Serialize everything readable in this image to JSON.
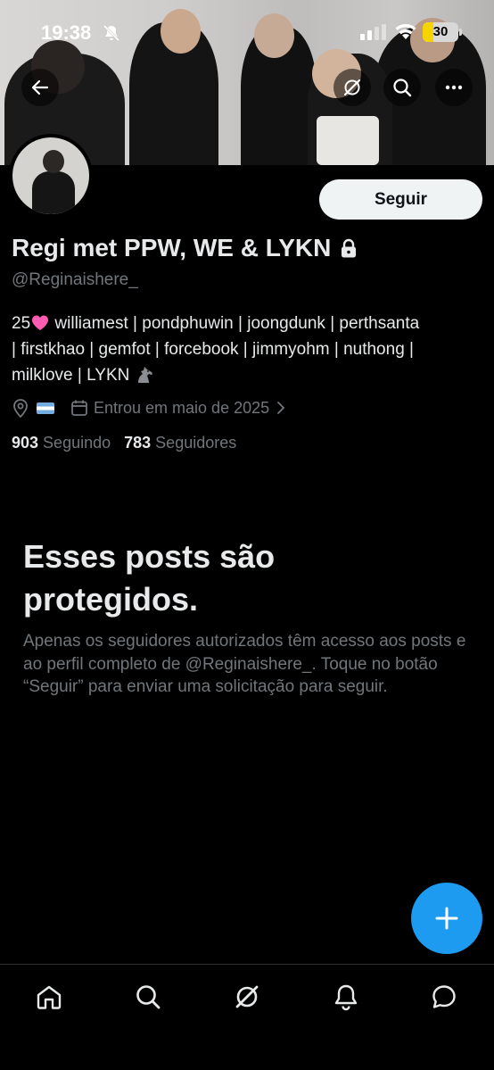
{
  "status_bar": {
    "time": "19:38",
    "battery_level": "30",
    "battery_fraction": 0.3
  },
  "profile": {
    "follow_label": "Seguir",
    "display_name": "Regi met PPW, WE & LYKN",
    "handle": "@Reginaishere_",
    "bio_age": "25",
    "bio_line1_text": " williamest | pondphuwin | joongdunk | perthsanta",
    "bio_line2": "| firstkhao | gemfot | forcebook | jimmyohm | nuthong |",
    "bio_line3_text": "milklove | LYKN ",
    "joined": "Entrou em maio de 2025",
    "following_count": "903",
    "following_label": "Seguindo",
    "followers_count": "783",
    "followers_label": "Seguidores"
  },
  "protected": {
    "title": "Esses posts são protegidos.",
    "description": "Apenas os seguidores autorizados têm acesso aos posts e ao perfil completo de @Reginaishere_. Toque no botão “Seguir” para enviar uma solicitação para seguir."
  },
  "icons": {
    "back": "back-arrow-icon",
    "grok": "grok-icon",
    "search": "search-icon",
    "more": "more-icon",
    "lock": "lock-icon",
    "location": "location-icon",
    "calendar": "calendar-icon",
    "compose": "plus-icon",
    "home": "home-icon",
    "explore": "search-icon",
    "notifications": "bell-icon",
    "messages": "message-icon"
  },
  "colors": {
    "accent": "#1d9bf0",
    "background": "#000000",
    "muted": "#71767b",
    "battery": "#f5d400"
  }
}
